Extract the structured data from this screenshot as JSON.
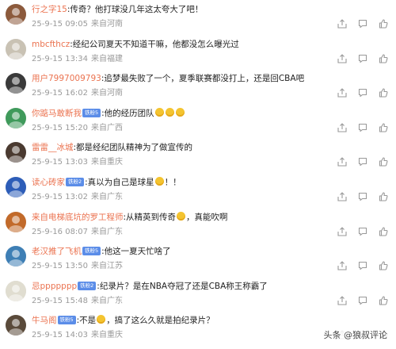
{
  "comments": [
    {
      "user": "行之字15",
      "badge": "",
      "text": ":传奇？他打球没几年这太夸大了吧！",
      "emojis": 0,
      "suffix": "",
      "time": "25-9-15 09:05",
      "location": "来自河南",
      "avatar_color": "#8c5a3c"
    },
    {
      "user": "mbcfthcz",
      "badge": "",
      "text": ":经纪公司夏天不知道干嘛，他都没怎么曝光过",
      "emojis": 0,
      "suffix": "",
      "time": "25-9-15 13:34",
      "location": "来自福建",
      "avatar_color": "#c9c2b4"
    },
    {
      "user": "用户7997009793",
      "badge": "",
      "text": ":追梦最失败了一个，夏季联赛都没打上，还是回CBA吧",
      "emojis": 0,
      "suffix": "",
      "time": "25-9-15 16:02",
      "location": "来自河南",
      "avatar_color": "#3a3a3a"
    },
    {
      "user": "你踮马敢断我",
      "badge": "铁粉5",
      "text": ":他的经历团队",
      "emojis": 3,
      "suffix": "",
      "time": "25-9-15 15:20",
      "location": "来自广西",
      "avatar_color": "#3f9a5b"
    },
    {
      "user": "雷雷__冰城",
      "badge": "",
      "text": ":都是经纪团队精神为了做宣传的",
      "emojis": 0,
      "suffix": "",
      "time": "25-9-15 13:03",
      "location": "来自重庆",
      "avatar_color": "#4a3a30"
    },
    {
      "user": "读心砖家",
      "badge": "铁粉2",
      "text": ":真以为自己是球星",
      "emojis": 1,
      "suffix": "！！",
      "time": "25-9-15 13:02",
      "location": "来自广东",
      "avatar_color": "#2d5db8"
    },
    {
      "user": "来自电梯底坑的罗工程师",
      "badge": "",
      "text": ":从精英到传奇",
      "emojis": 1,
      "suffix": "，真能吹啊",
      "time": "25-9-16 08:07",
      "location": "来自广东",
      "avatar_color": "#c26a2a"
    },
    {
      "user": "老汉推了飞机",
      "badge": "铁粉5",
      "text": ":他这一夏天忙啥了",
      "emojis": 0,
      "suffix": "",
      "time": "25-9-15 13:50",
      "location": "来自江苏",
      "avatar_color": "#3e7fb5"
    },
    {
      "user": "忌ppppppp",
      "badge": "铁粉2",
      "text": ":纪录片？是在NBA夺冠了还是CBA称王称霸了",
      "emojis": 0,
      "suffix": "",
      "time": "25-9-15 15:48",
      "location": "来自广东",
      "avatar_color": "#e0ddd0"
    },
    {
      "user": "牛马阁",
      "badge": "铁粉5",
      "text": ":不是",
      "emojis": 1,
      "suffix": "，搞了这么久就是拍纪录片？",
      "time": "25-9-15 14:03",
      "location": "来自重庆",
      "avatar_color": "#5a4a3a"
    }
  ],
  "watermark": "头条 @狼叔评论"
}
